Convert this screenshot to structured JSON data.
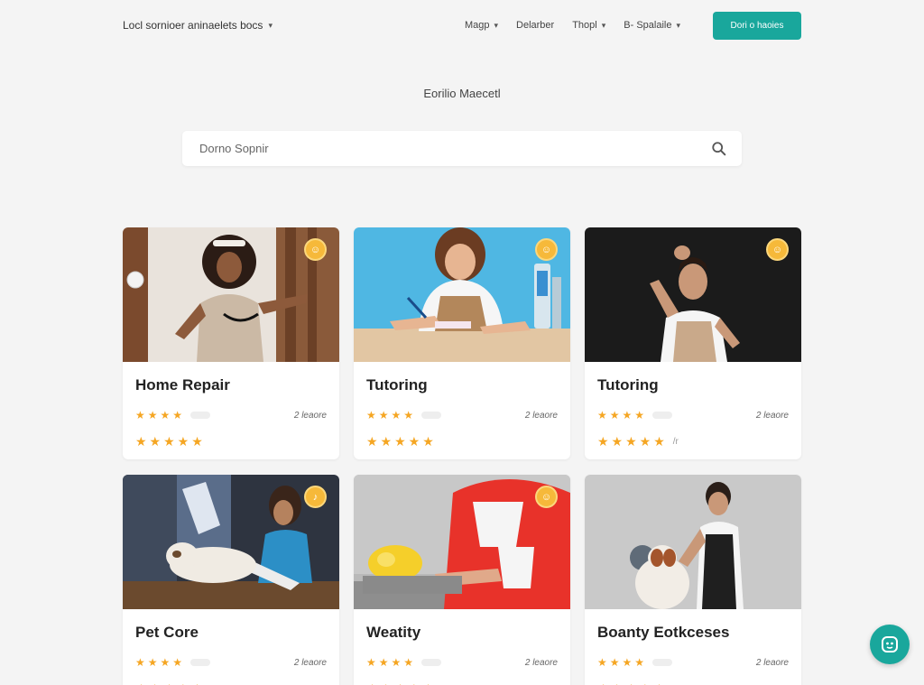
{
  "header": {
    "brand": "Locl sornioer aninaelets bocs",
    "nav": [
      {
        "label": "Magp",
        "dropdown": true
      },
      {
        "label": "Delarber",
        "dropdown": false
      },
      {
        "label": "Thopl",
        "dropdown": true
      },
      {
        "label": "B- Spalaile",
        "dropdown": true
      }
    ],
    "cta_label": "Dori o haoies"
  },
  "hero": {
    "subtitle": "Eorilio Maecetl",
    "search_placeholder": "Dorno Sopnir"
  },
  "cards": [
    {
      "title": "Home Repair",
      "count": "2 leaore",
      "stars": "★★★★",
      "stars_big": "★★★★★",
      "extra": "",
      "badge": "☺"
    },
    {
      "title": "Tutoring",
      "count": "2 leaore",
      "stars": "★★★★",
      "stars_big": "★★★★★",
      "extra": "",
      "badge": "☺"
    },
    {
      "title": "Tutoring",
      "count": "2 leaore",
      "stars": "★★★★",
      "stars_big": "★★★★★",
      "extra": "/r",
      "badge": "☺"
    },
    {
      "title": "Pet Core",
      "count": "2 leaore",
      "stars": "★★★★",
      "stars_big": "★★★★★",
      "extra": "",
      "badge": "♪"
    },
    {
      "title": "Weatity",
      "count": "2 leaore",
      "stars": "★★★★",
      "stars_big": "★★★★★",
      "extra": "",
      "badge": "☺"
    },
    {
      "title": "Boanty Eotkceses",
      "count": "2 leaore",
      "stars": "★★★★",
      "stars_big": "★★★★★",
      "extra": "",
      "badge": ""
    }
  ],
  "colors": {
    "accent": "#19a79c",
    "star": "#f5a623",
    "badge": "#f6b93a",
    "background": "#f4f4f4"
  },
  "icons": {
    "search": "search-icon",
    "chat": "chat-icon",
    "chevron": "chevron-down-icon"
  }
}
